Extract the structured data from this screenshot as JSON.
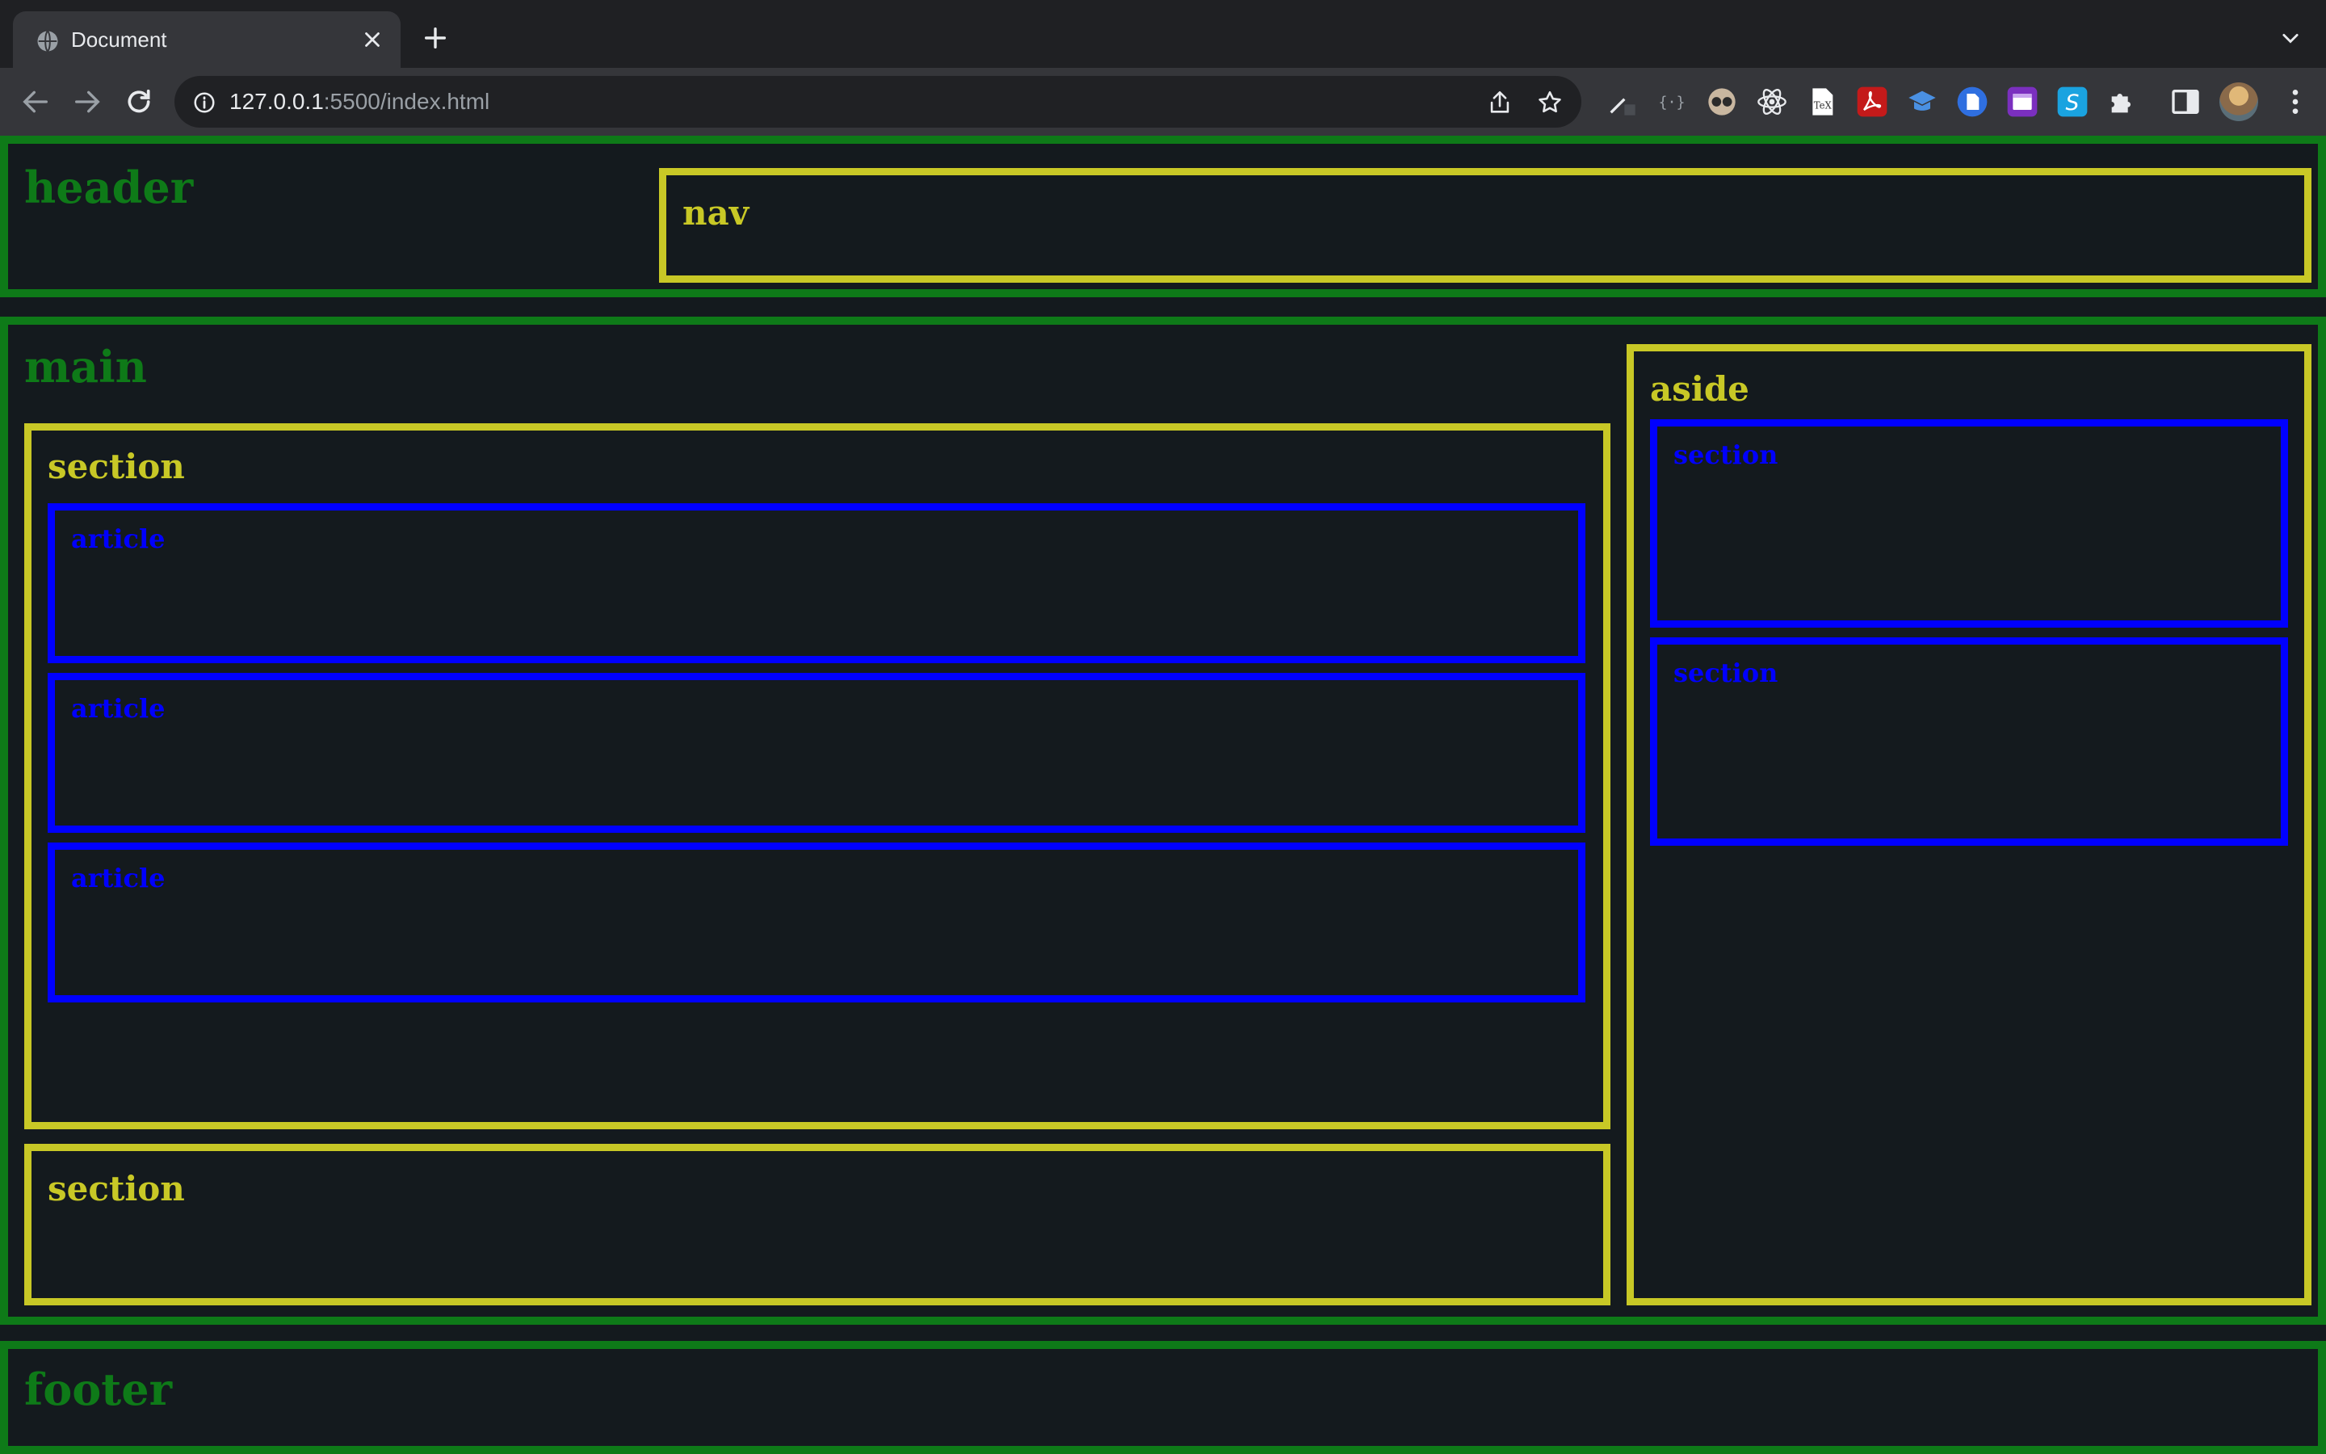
{
  "browser": {
    "tab_title": "Document",
    "url_host": "127.0.0.1",
    "url_rest": ":5500/index.html",
    "icons": {
      "favicon": "globe-icon",
      "close": "close-icon",
      "new_tab": "plus-icon",
      "tab_search": "chevron-down-icon",
      "back": "back-arrow-icon",
      "forward": "forward-arrow-icon",
      "reload": "reload-icon",
      "site_info": "info-icon",
      "share": "share-icon",
      "bookmark": "star-icon",
      "menu": "kebab-menu-icon"
    },
    "extensions": [
      "eyedropper-extension-icon",
      "json-formatter-extension-icon",
      "glasses-extension-icon",
      "react-devtools-extension-icon",
      "tex-extension-icon",
      "acrobat-extension-icon",
      "graduation-cap-extension-icon",
      "document-extension-icon",
      "window-extension-icon",
      "s-extension-icon",
      "puzzle-extensions-icon",
      "side-panel-icon"
    ]
  },
  "page": {
    "header_label": "header",
    "nav_label": "nav",
    "main_label": "main",
    "section1_label": "section",
    "article1_label": "article",
    "article2_label": "article",
    "article3_label": "article",
    "section2_label": "section",
    "aside_label": "aside",
    "aside_section1_label": "section",
    "aside_section2_label": "section",
    "footer_label": "footer"
  },
  "colors": {
    "green_outline": "#0e7a18",
    "yellow_outline": "#c8c826",
    "blue_outline": "#0000ff",
    "page_background": "#141a1e"
  }
}
